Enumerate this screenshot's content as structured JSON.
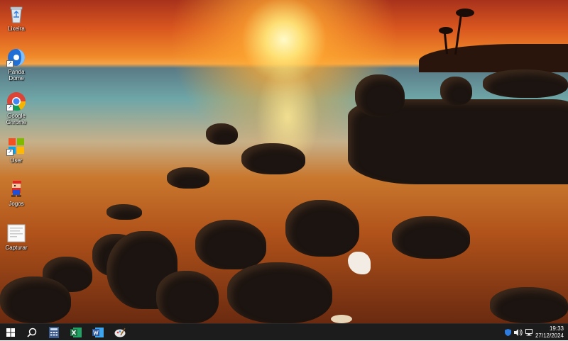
{
  "desktop": {
    "icons": [
      {
        "label": "Lixeira",
        "icon": "recycle-bin-icon"
      },
      {
        "label": "Panda Dome",
        "icon": "panda-dome-icon"
      },
      {
        "label": "Google Chrome",
        "icon": "chrome-icon"
      },
      {
        "label": "User",
        "icon": "windows-logo-icon"
      },
      {
        "label": "Jogos",
        "icon": "mario-icon"
      },
      {
        "label": "Capturar",
        "icon": "screenshot-file-icon"
      }
    ]
  },
  "taskbar": {
    "pinned": [
      {
        "name": "start",
        "icon": "windows-start-icon"
      },
      {
        "name": "search",
        "icon": "search-icon"
      },
      {
        "name": "calculator",
        "icon": "calculator-icon"
      },
      {
        "name": "excel",
        "icon": "excel-icon"
      },
      {
        "name": "word",
        "icon": "word-icon"
      },
      {
        "name": "paint",
        "icon": "paint-icon"
      }
    ],
    "tray_icons": [
      "defender-icon",
      "volume-icon",
      "network-icon"
    ],
    "clock": {
      "time": "19:33",
      "date": "27/12/2024"
    }
  },
  "colors": {
    "taskbar": "#1c1c1c",
    "excel": "#1e7145",
    "word": "#2b579a"
  }
}
